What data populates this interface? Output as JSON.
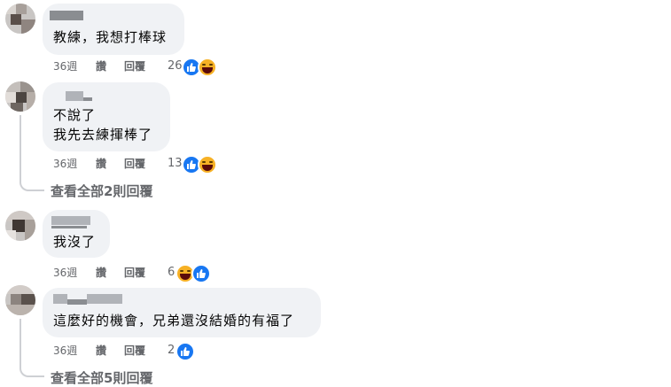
{
  "comments": [
    {
      "text_lines": [
        "教練，我想打棒球"
      ],
      "time": "36週",
      "like_label": "讚",
      "reply_label": "回覆",
      "reaction_count": "26",
      "reactions": [
        "like-icon",
        "haha-icon"
      ]
    },
    {
      "text_lines": [
        "不說了",
        "我先去練揮棒了"
      ],
      "time": "36週",
      "like_label": "讚",
      "reply_label": "回覆",
      "reaction_count": "13",
      "reactions": [
        "like-icon",
        "haha-icon"
      ],
      "view_replies": "查看全部2則回覆"
    },
    {
      "text_lines": [
        "我沒了"
      ],
      "time": "36週",
      "like_label": "讚",
      "reply_label": "回覆",
      "reaction_count": "6",
      "reactions": [
        "haha-icon",
        "like-icon"
      ]
    },
    {
      "text_lines": [
        "這麼好的機會，兄弟還沒結婚的有福了"
      ],
      "time": "36週",
      "like_label": "讚",
      "reply_label": "回覆",
      "reaction_count": "2",
      "reactions": [
        "like-icon"
      ],
      "view_replies": "查看全部5則回覆"
    }
  ],
  "colors": {
    "bubble": "#f0f2f5",
    "meta_text": "#65676b",
    "like_blue": "#1877f2",
    "haha_yellow": "#f7b125"
  }
}
